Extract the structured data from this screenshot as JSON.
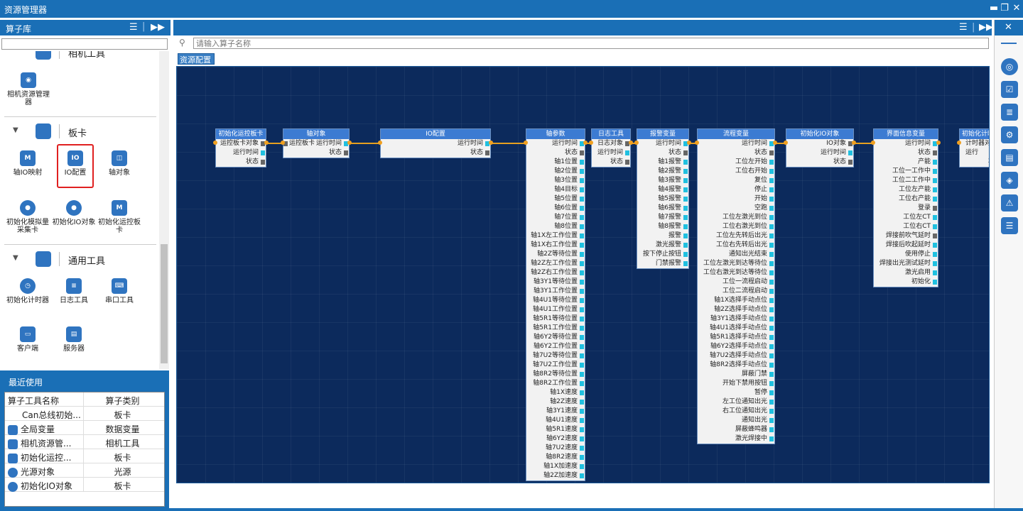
{
  "window": {
    "title": "资源管理器"
  },
  "left": {
    "header": "算子库",
    "categories": [
      {
        "label": "相机工具",
        "tools": [
          "相机资源管理器"
        ]
      },
      {
        "label": "板卡",
        "tools": [
          "轴IO映射",
          "IO配置",
          "轴对象",
          "初始化模拟量采集卡",
          "初始化IO对象",
          "初始化运控板卡"
        ]
      },
      {
        "label": "通用工具",
        "tools": [
          "初始化计时器",
          "日志工具",
          "串口工具",
          "客户端",
          "服务器"
        ]
      }
    ]
  },
  "recent": {
    "title": "最近使用",
    "headers": [
      "算子工具名称",
      "算子类别"
    ],
    "rows": [
      {
        "name": "Can总线初始...",
        "category": "板卡"
      },
      {
        "name": "全局变量",
        "category": "数据变量"
      },
      {
        "name": "相机资源管...",
        "category": "相机工具"
      },
      {
        "name": "初始化运控...",
        "category": "板卡"
      },
      {
        "name": "光源对象",
        "category": "光源"
      },
      {
        "name": "初始化IO对象",
        "category": "板卡"
      }
    ]
  },
  "center": {
    "search_placeholder": "请输入算子名称",
    "tab": "资源配置"
  },
  "nodes": [
    {
      "title": "初始化运控板卡",
      "ports": [
        "运控板卡对象",
        "运行时间",
        "状态"
      ]
    },
    {
      "title": "轴对象",
      "ports": [
        "运控板卡",
        "运行时间",
        "状态"
      ]
    },
    {
      "title": "IO配置",
      "ports": [
        "运行时间",
        "状态"
      ]
    },
    {
      "title": "轴参数",
      "ports": [
        "运行时间",
        "状态",
        "轴1位置",
        "轴2位置",
        "轴3位置",
        "轴4目标",
        "轴5位置",
        "轴6位置",
        "轴7位置",
        "轴8位置",
        "轴1X左工作位置",
        "轴1X右工作位置",
        "轴2Z等待位置",
        "轴2Z左工作位置",
        "轴2Z右工作位置",
        "轴3Y1等待位置",
        "轴3Y1工作位置",
        "轴4U1等待位置",
        "轴4U1工作位置",
        "轴5R1等待位置",
        "轴5R1工作位置",
        "轴6Y2等待位置",
        "轴6Y2工作位置",
        "轴7U2等待位置",
        "轴7U2工作位置",
        "轴8R2等待位置",
        "轴8R2工作位置",
        "轴1X速度",
        "轴2Z速度",
        "轴3Y1速度",
        "轴4U1速度",
        "轴5R1速度",
        "轴6Y2速度",
        "轴7U2速度",
        "轴8R2速度",
        "轴1X加速度",
        "轴2Z加速度"
      ]
    },
    {
      "title": "日志工具",
      "ports": [
        "日志对象",
        "运行时间",
        "状态"
      ]
    },
    {
      "title": "报警变量",
      "ports": [
        "运行时间",
        "状态",
        "轴1报警",
        "轴2报警",
        "轴3报警",
        "轴4报警",
        "轴5报警",
        "轴6报警",
        "轴7报警",
        "轴8报警",
        "报警",
        "激光报警",
        "按下停止按钮",
        "门禁报警"
      ]
    },
    {
      "title": "流程变量",
      "ports": [
        "运行时间",
        "状态",
        "工位左开始",
        "工位右开始",
        "复位",
        "停止",
        "开始",
        "空跑",
        "工位左激光到位",
        "工位右激光到位",
        "工位左先转后出光",
        "工位右先转后出光",
        "通知出光结束",
        "工位左激光到达等待位",
        "工位右激光到达等待位",
        "工位一流程启动",
        "工位二流程启动",
        "轴1X选择手动点位",
        "轴2Z选择手动点位",
        "轴3Y1选择手动点位",
        "轴4U1选择手动点位",
        "轴5R1选择手动点位",
        "轴6Y2选择手动点位",
        "轴7U2选择手动点位",
        "轴8R2选择手动点位",
        "屏蔽门禁",
        "开始下禁用按钮",
        "暂停",
        "左工位通知出光",
        "右工位通知出光",
        "通知出光",
        "屏蔽蜂鸣器",
        "激光焊接中"
      ]
    },
    {
      "title": "初始化IO对象",
      "ports": [
        "IO对象",
        "运行时间",
        "状态"
      ]
    },
    {
      "title": "界面信息变量",
      "ports": [
        "运行时间",
        "状态",
        "产能",
        "工位一工作中",
        "工位二工作中",
        "工位左产能",
        "工位右产能",
        "登录",
        "工位左CT",
        "工位右CT",
        "焊接前吹气延时",
        "焊接后吹起延时",
        "使用停止",
        "焊接出光测试延时",
        "激光启用",
        "初始化"
      ]
    },
    {
      "title": "初始化计时",
      "ports": [
        "计时器对",
        "运行",
        "状"
      ]
    }
  ]
}
